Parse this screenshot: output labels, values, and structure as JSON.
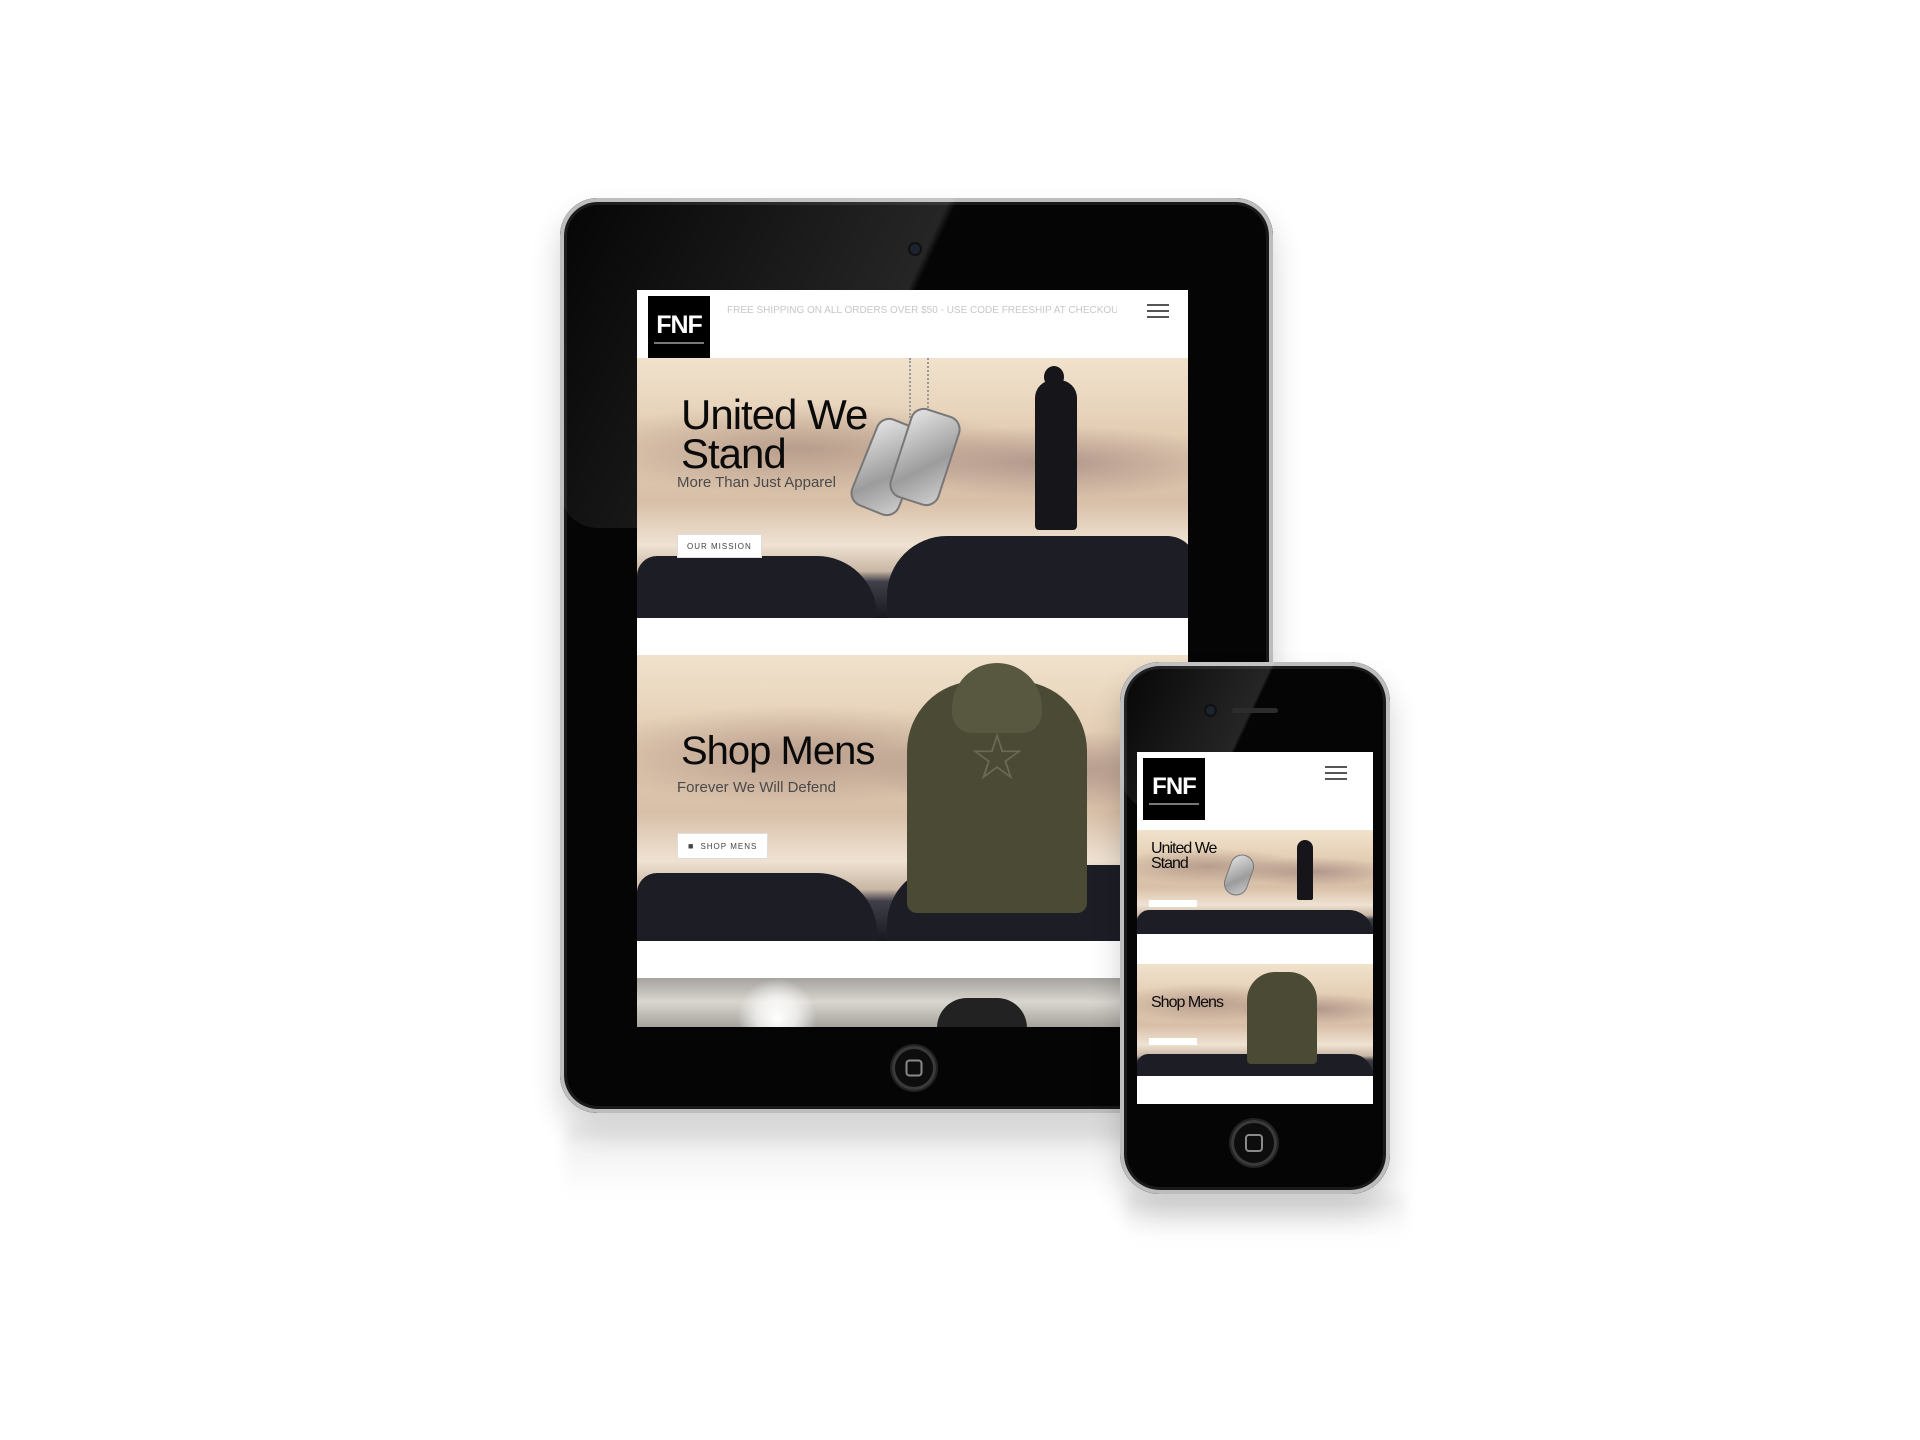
{
  "site": {
    "logo_text": "FNF",
    "announcement": "FREE SHIPPING ON ALL ORDERS OVER $50 - USE CODE FREESHIP AT CHECKOUT",
    "menu_icon": "hamburger-menu-icon"
  },
  "banners": [
    {
      "title_line1": "United We",
      "title_line2": "Stand",
      "subtitle": "More Than Just Apparel",
      "button_label": "OUR MISSION"
    },
    {
      "title_line1": "Shop Mens",
      "subtitle": "Forever We Will Defend",
      "button_label": "SHOP MENS",
      "button_icon": "shopping-bag-icon"
    }
  ],
  "phone": {
    "banners": [
      {
        "title_line1": "United We",
        "title_line2": "Stand"
      },
      {
        "title_line1": "Shop Mens"
      }
    ]
  },
  "colors": {
    "device_body": "#050505",
    "logo_bg": "#000000",
    "hoodie": "#4b4a35"
  }
}
